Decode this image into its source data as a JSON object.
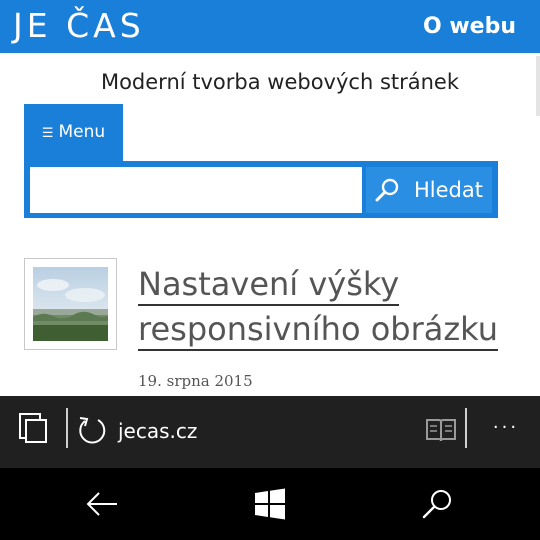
{
  "header": {
    "logo": "JE ČAS",
    "nav_link": "O webu",
    "brand_color": "#1a7fd8"
  },
  "tagline": "Moderní tvorba webových stránek",
  "menu": {
    "label": "Menu",
    "icon": "hamburger-icon"
  },
  "search": {
    "value": "",
    "button_label": "Hledat",
    "icon": "search-icon"
  },
  "article": {
    "title_line1": "Nastavení výšky",
    "title_line2": "responsivního obrázku",
    "date": "19. srpna 2015",
    "thumbnail": "landscape-thumbnail"
  },
  "browser": {
    "url": "jecas.cz",
    "tabs_icon": "tabs-icon",
    "reload_icon": "reload-icon",
    "reading_icon": "reading-view-icon",
    "more_icon": "more-icon",
    "bar_color": "#202020"
  },
  "os_nav": {
    "back_icon": "back-arrow-icon",
    "home_icon": "windows-logo-icon",
    "search_icon": "search-icon"
  }
}
